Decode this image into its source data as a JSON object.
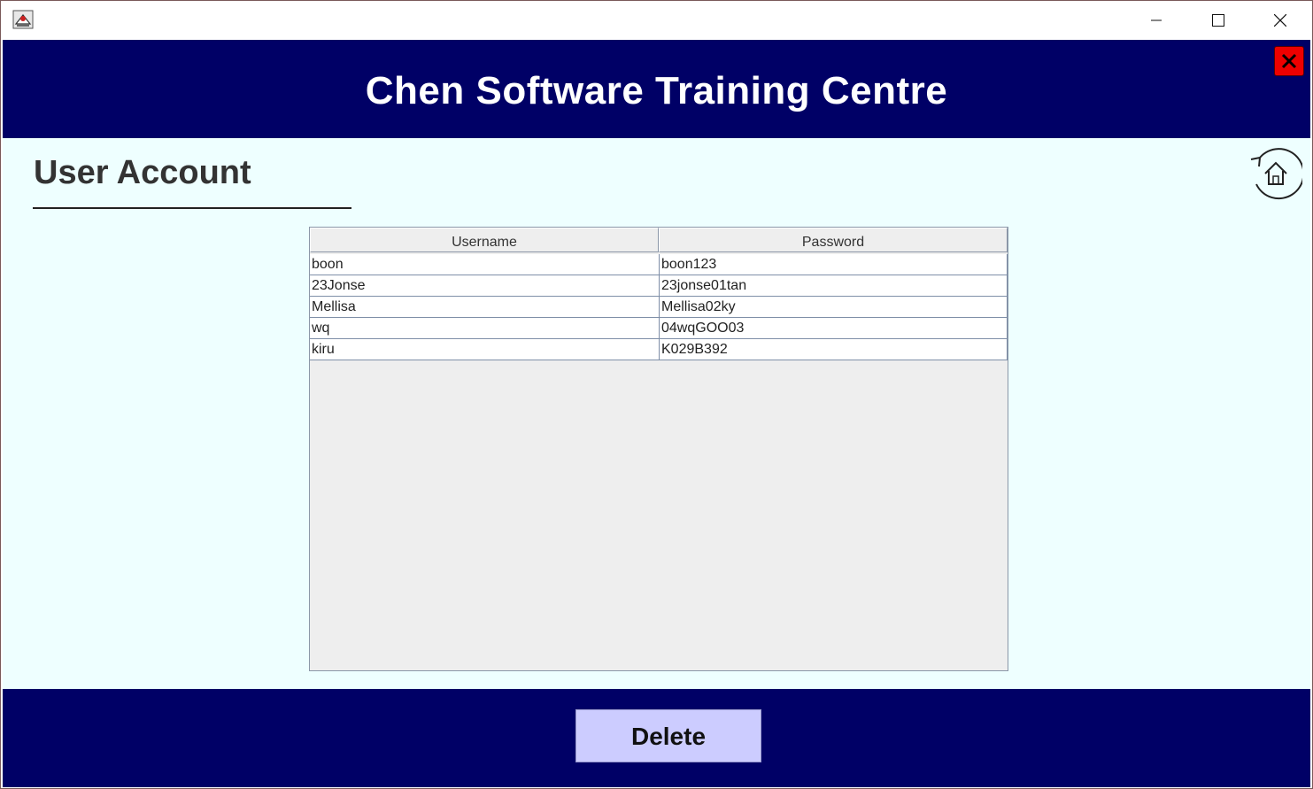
{
  "window": {
    "app_icon": "java-cup-icon",
    "controls": [
      "minimize-icon",
      "maximize-icon",
      "close-icon"
    ]
  },
  "header": {
    "title": "Chen Software Training Centre",
    "exit_icon": "red-x-icon"
  },
  "page": {
    "title": "User Account",
    "home_icon": "home-back-icon"
  },
  "table": {
    "columns": [
      "Username",
      "Password"
    ],
    "rows": [
      [
        "boon",
        "boon123"
      ],
      [
        "23Jonse",
        "23jonse01tan"
      ],
      [
        "Mellisa",
        "Mellisa02ky"
      ],
      [
        "wq",
        "04wqGOO03"
      ],
      [
        "kiru",
        "K029B392"
      ]
    ]
  },
  "footer": {
    "delete_label": "Delete"
  },
  "colors": {
    "header_bg": "#000066",
    "content_bg": "#eeffff",
    "button_bg": "#ccccff",
    "exit_bg": "#ee0000"
  }
}
